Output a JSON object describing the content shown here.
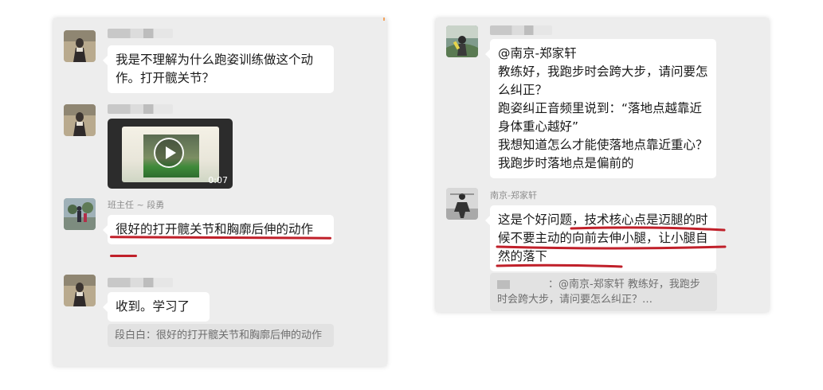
{
  "left_chat": {
    "messages": [
      {
        "text": "我是不理解为什么跑姿训练做这个动作。打开髋关节？"
      },
      {
        "video_duration": "0:07"
      },
      {
        "sender": "班主任 ~ 段勇",
        "text": "很好的打开髋关节和胸廓后伸的动作"
      },
      {
        "text": "收到。学习了",
        "quote": "段白白：很好的打开髋关节和胸廓后伸的动作"
      }
    ]
  },
  "right_chat": {
    "messages": [
      {
        "lines": [
          "@南京-郑家轩",
          "教练好，我跑步时会跨大步，请问要怎么纠正？",
          "跑姿纠正音频里说到：“落地点越靠近身体重心越好”",
          "我想知道怎么才能使落地点靠近重心？我跑步时落地点是偏前的"
        ]
      },
      {
        "sender": "南京-郑家轩",
        "text": "这是个好问题，技术核心点是迈腿的时候不要主动的向前去伸小腿，让小腿自然的落下",
        "quote": "：@南京-郑家轩 教练好，我跑步时会跨大步，请问要怎么纠正？…"
      }
    ]
  },
  "colors": {
    "panel_bg": "#ededed",
    "bubble_bg": "#ffffff",
    "underline": "#c0202a"
  }
}
